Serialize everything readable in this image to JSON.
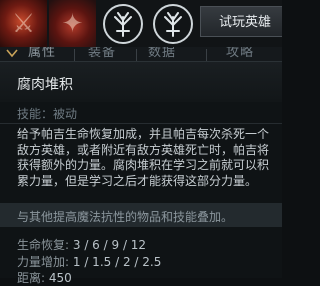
{
  "topbar": {
    "try_hero_label": "试玩英雄"
  },
  "tabs": [
    {
      "label": "属性"
    },
    {
      "label": "装备"
    },
    {
      "label": "数据"
    },
    {
      "label": "攻略"
    }
  ],
  "tooltip": {
    "title": "腐肉堆积",
    "type": "技能：被动",
    "description": "给予帕吉生命恢复加成，并且帕吉每次杀死一个敌方英雄，或者附近有敌方英雄死亡时，帕吉将获得额外的力量。腐肉堆积在学习之前就可以积累力量，但是学习之后才能获得这部分力量。",
    "note": "与其他提高魔法抗性的物品和技能叠加。",
    "stats": [
      {
        "label": "生命恢复:",
        "value": "3 / 6 / 9 / 12"
      },
      {
        "label": "力量增加:",
        "value": "1 / 1.5 / 2 / 2.5"
      },
      {
        "label": "距离:",
        "value": "450"
      }
    ]
  },
  "colors": {
    "background": "#0d1012",
    "tooltip_bg": "#0f1315",
    "note_band": "#232a2e",
    "title_text": "#e4e8ea",
    "muted_text": "#6e7a82"
  },
  "icons": [
    "hero-portrait-icon",
    "talent-tree-icon",
    "caret-down-icon"
  ]
}
